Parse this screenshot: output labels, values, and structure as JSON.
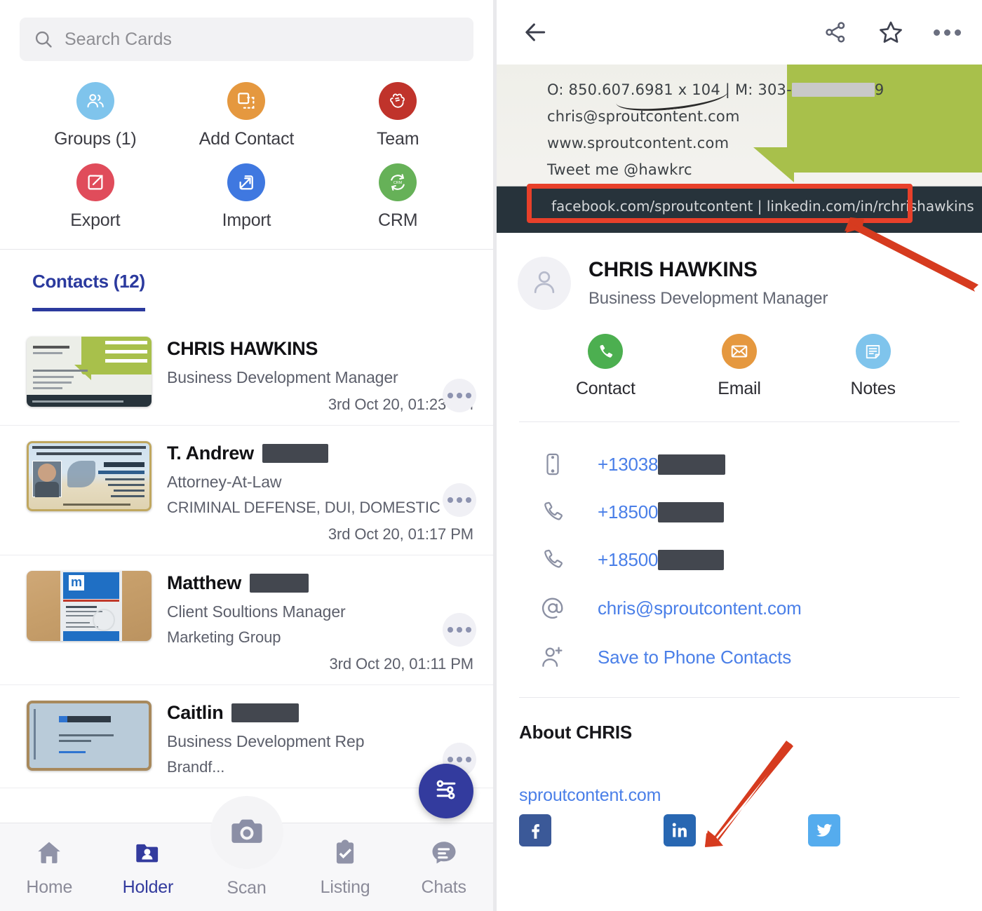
{
  "colors": {
    "brand_navy": "#333b9e",
    "link_blue": "#4a7fe8",
    "groups_blue": "#7fc4ec",
    "add_contact_orange": "#e5983f",
    "team_red": "#c0332b",
    "export_red": "#e04c5b",
    "import_blue": "#3f78e0",
    "crm_green": "#66b158",
    "contact_green": "#4caf50",
    "email_orange": "#e5983f",
    "notes_blue": "#7fc4ec",
    "annotation_red": "#e8402a",
    "redaction_gray": "#43474f",
    "facebook_blue": "#3b5998",
    "linkedin_blue": "#2867b2",
    "twitter_blue": "#55acee"
  },
  "left": {
    "search": {
      "placeholder": "Search Cards",
      "value": "",
      "icon": "search-icon"
    },
    "quick_actions": [
      {
        "label": "Groups (1)",
        "icon": "groups-icon",
        "color": "#7fc4ec"
      },
      {
        "label": "Add Contact",
        "icon": "add-contact-icon",
        "color": "#e5983f"
      },
      {
        "label": "Team",
        "icon": "team-icon",
        "color": "#c0332b"
      },
      {
        "label": "Export",
        "icon": "export-icon",
        "color": "#e04c5b"
      },
      {
        "label": "Import",
        "icon": "import-icon",
        "color": "#3f78e0"
      },
      {
        "label": "CRM",
        "icon": "crm-sync-icon",
        "color": "#66b158"
      }
    ],
    "tabs": [
      {
        "label": "Contacts (12)",
        "active": true
      }
    ],
    "contacts": [
      {
        "name": "CHRIS HAWKINS",
        "name_redacted": false,
        "title": "Business Development Manager",
        "subtitle": "",
        "timestamp": "3rd Oct 20, 01:23 PM",
        "card_style": "sprout"
      },
      {
        "name": "T. Andrew",
        "name_redacted": true,
        "title": "Attorney-At-Law",
        "subtitle": "CRIMINAL DEFENSE, DUI, DOMESTIC VI...",
        "timestamp": "3rd Oct 20, 01:17 PM",
        "card_style": "lawyer"
      },
      {
        "name": "Matthew",
        "name_redacted": true,
        "title": "Client Soultions Manager",
        "subtitle": "Marketing Group",
        "timestamp": "3rd Oct 20, 01:11 PM",
        "card_style": "mg"
      },
      {
        "name": "Caitlin",
        "name_redacted": true,
        "title": "Business Development Rep",
        "subtitle": "Brandf...",
        "timestamp": "",
        "card_style": "brandfolder"
      }
    ],
    "fab": {
      "icon": "filter-sliders-icon",
      "label": ""
    },
    "bottom_nav": [
      {
        "label": "Home",
        "icon": "home-icon",
        "active": false
      },
      {
        "label": "Holder",
        "icon": "contact-folder-icon",
        "active": true
      },
      {
        "label": "Scan",
        "icon": "camera-icon",
        "active": false
      },
      {
        "label": "Listing",
        "icon": "clipboard-check-icon",
        "active": false
      },
      {
        "label": "Chats",
        "icon": "chat-bubble-icon",
        "active": false
      }
    ]
  },
  "right": {
    "header": {
      "back_icon": "arrow-left-icon",
      "share_icon": "share-icon",
      "favorite_icon": "star-outline-icon",
      "more_icon": "more-horizontal-icon"
    },
    "card_image": {
      "lines": [
        "O: 850.607.6981 x 104 | M: 303-",
        "chris@sproutcontent.com",
        "www.sproutcontent.com",
        "Tweet me @hawkrc"
      ],
      "phone_suffix": "9",
      "footer": "facebook.com/sproutcontent  | linkedin.com/in/rchrishawkins"
    },
    "profile": {
      "avatar_icon": "person-icon",
      "name": "CHRIS HAWKINS",
      "title": "Business Development Manager"
    },
    "quick_actions": [
      {
        "label": "Contact",
        "icon": "phone-icon",
        "color": "#4caf50"
      },
      {
        "label": "Email",
        "icon": "envelope-icon",
        "color": "#e5983f"
      },
      {
        "label": "Notes",
        "icon": "notes-icon",
        "color": "#7fc4ec"
      }
    ],
    "fields": [
      {
        "icon": "mobile-phone-icon",
        "value": "+13038",
        "redacted": true,
        "redact_width": 96
      },
      {
        "icon": "phone-handset-icon",
        "value": "+18500",
        "redacted": true,
        "redact_width": 94
      },
      {
        "icon": "phone-handset-icon",
        "value": "+18500",
        "redacted": true,
        "redact_width": 94
      },
      {
        "icon": "at-sign-icon",
        "value": "chris@sproutcontent.com",
        "redacted": false,
        "redact_width": 0
      },
      {
        "icon": "add-person-icon",
        "value": "Save to Phone Contacts",
        "redacted": false,
        "redact_width": 0
      }
    ],
    "about": {
      "heading": "About CHRIS",
      "website": "sproutcontent.com",
      "socials": [
        {
          "icon": "facebook-icon",
          "color": "#3b5998"
        },
        {
          "icon": "linkedin-icon",
          "color": "#2867b2"
        },
        {
          "icon": "twitter-icon",
          "color": "#55acee"
        }
      ]
    }
  }
}
